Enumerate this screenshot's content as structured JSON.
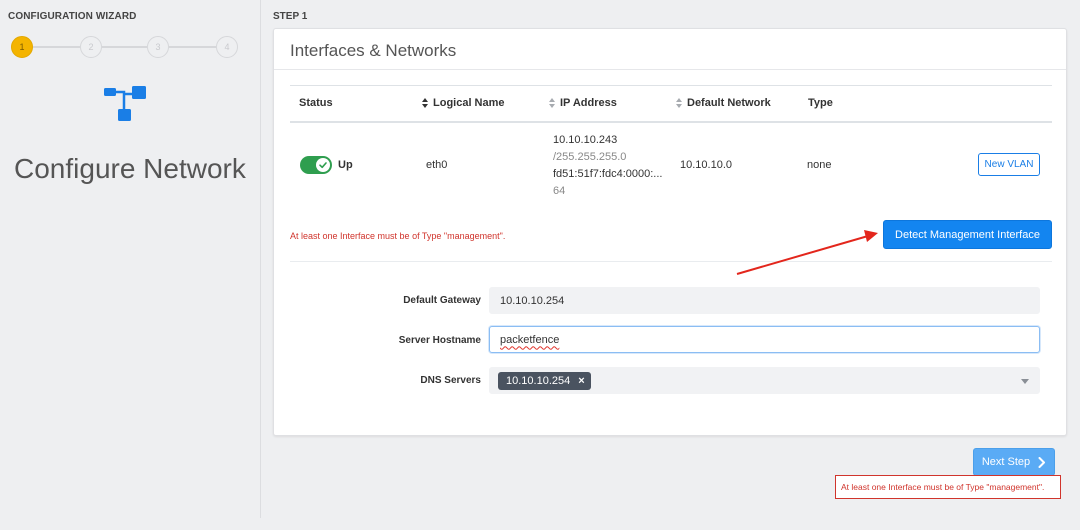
{
  "sidebar": {
    "wizard_title": "CONFIGURATION WIZARD",
    "steps": [
      {
        "label": "1",
        "state": "active"
      },
      {
        "label": "2",
        "state": "inactive"
      },
      {
        "label": "3",
        "state": "inactive"
      },
      {
        "label": "4",
        "state": "inactive"
      }
    ],
    "icon": "network-diagram-icon",
    "page_title": "Configure Network"
  },
  "step_label": "STEP 1",
  "card": {
    "title": "Interfaces & Networks",
    "table": {
      "headers": {
        "status": "Status",
        "logical_name": "Logical Name",
        "ip_address": "IP Address",
        "default_network": "Default Network",
        "type": "Type"
      },
      "row": {
        "status_enabled": true,
        "status_label": "Up",
        "logical_name": "eth0",
        "ip_address_line1": "10.10.10.243",
        "ip_address_line2": "/255.255.255.0",
        "ip_address_line3": "fd51:51f7:fdc4:0000:...",
        "ip_address_line4": "64",
        "default_network": "10.10.10.0",
        "type": "none",
        "new_vlan_label": "New VLAN"
      }
    },
    "error_message": "At least one Interface must be of Type \"management\".",
    "detect_button_label": "Detect Management Interface",
    "form": {
      "gateway_label": "Default Gateway",
      "gateway_value": "10.10.10.254",
      "hostname_label": "Server Hostname",
      "hostname_value": "packetfence",
      "dns_label": "DNS Servers",
      "dns_tags": [
        "10.10.10.254"
      ],
      "dns_tag_remove": "×"
    }
  },
  "footer": {
    "next_label": "Next Step",
    "next_error": "At least one Interface must be of Type \"management\"."
  },
  "colors": {
    "accent": "#1385f0",
    "active_step": "#f4b400",
    "toggle_on": "#2f9e4f",
    "error": "#d0342c"
  }
}
